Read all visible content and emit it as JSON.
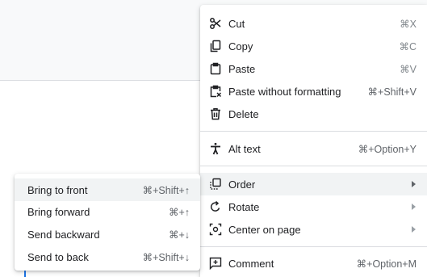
{
  "context_menu": {
    "items": [
      {
        "label": "Cut",
        "shortcut": "⌘X",
        "icon": "scissors-icon"
      },
      {
        "label": "Copy",
        "shortcut": "⌘C",
        "icon": "copy-icon"
      },
      {
        "label": "Paste",
        "shortcut": "⌘V",
        "icon": "clipboard-icon"
      },
      {
        "label": "Paste without formatting",
        "shortcut": "⌘+Shift+V",
        "icon": "clipboard-format-icon"
      },
      {
        "label": "Delete",
        "shortcut": "",
        "icon": "trash-icon"
      },
      {
        "label": "Alt text",
        "shortcut": "⌘+Option+Y",
        "icon": "accessibility-icon"
      },
      {
        "label": "Order",
        "shortcut": "",
        "icon": "order-icon"
      },
      {
        "label": "Rotate",
        "shortcut": "",
        "icon": "rotate-icon"
      },
      {
        "label": "Center on page",
        "shortcut": "",
        "icon": "center-icon"
      },
      {
        "label": "Comment",
        "shortcut": "⌘+Option+M",
        "icon": "add-comment-icon"
      }
    ]
  },
  "order_submenu": {
    "items": [
      {
        "label": "Bring to front",
        "shortcut": "⌘+Shift+↑"
      },
      {
        "label": "Bring forward",
        "shortcut": "⌘+↑"
      },
      {
        "label": "Send backward",
        "shortcut": "⌘+↓"
      },
      {
        "label": "Send to back",
        "shortcut": "⌘+Shift+↓"
      }
    ]
  },
  "colors": {
    "hover_background": "#f1f3f4",
    "text": "#202124",
    "secondary_text": "#5f6368",
    "separator": "#dadce0",
    "accent": "#1a73e8"
  }
}
